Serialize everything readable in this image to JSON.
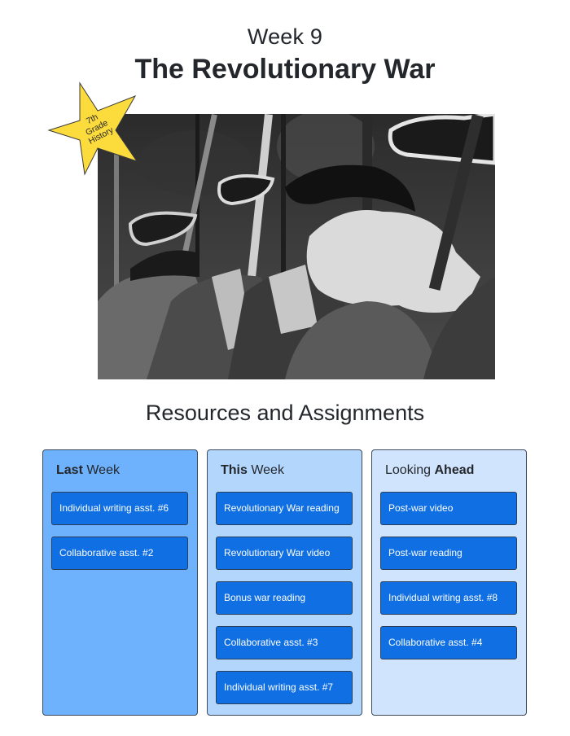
{
  "header": {
    "week_label": "Week 9",
    "title": "The Revolutionary War"
  },
  "hero_image": {
    "description": "black-and-white photo of Revolutionary War reenactors in tricorn hats carrying muskets"
  },
  "badge": {
    "shape": "star",
    "color": "#fcdb3c",
    "lines": [
      "7th",
      "Grade",
      "History"
    ]
  },
  "section": {
    "title": "Resources and Assignments"
  },
  "columns": [
    {
      "header_bold": "Last",
      "header_rest": " Week",
      "bg": "#6eb1fc",
      "items": [
        {
          "label": "Individual writing asst. #6"
        },
        {
          "label": "Collaborative asst. #2"
        }
      ]
    },
    {
      "header_bold": "This",
      "header_rest": " Week",
      "bg": "#b3d6fd",
      "items": [
        {
          "label": "Revolutionary War reading"
        },
        {
          "label": "Revolutionary War video"
        },
        {
          "label": "Bonus war reading"
        },
        {
          "label": "Collaborative asst. #3"
        },
        {
          "label": "Individual writing asst. #7"
        }
      ]
    },
    {
      "header_plain": "Looking ",
      "header_bold": "Ahead",
      "bg": "#d0e4fd",
      "items": [
        {
          "label": "Post-war video"
        },
        {
          "label": "Post-war reading"
        },
        {
          "label": "Individual writing asst. #8"
        },
        {
          "label": "Collaborative asst. #4"
        }
      ]
    }
  ],
  "colors": {
    "item_bg": "#0f6fe3",
    "text_dark": "#23272b",
    "item_text": "#ffffff"
  }
}
